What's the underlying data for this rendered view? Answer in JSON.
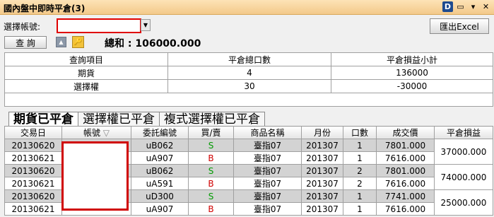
{
  "window": {
    "title": "國內盤中即時平倉(3)"
  },
  "toolbar_icons": [
    "d-app-icon",
    "page-icon",
    "pin-icon",
    "close-icon"
  ],
  "account": {
    "label": "選擇帳號:",
    "value": ""
  },
  "export_label": "匯出Excel",
  "query_label": "查 詢",
  "total": "總和 : 106000.000",
  "summary": {
    "headers": [
      "查詢項目",
      "平倉總口數",
      "平倉損益小計"
    ],
    "rows": [
      [
        "期貨",
        "4",
        "136000"
      ],
      [
        "選擇權",
        "30",
        "-30000"
      ]
    ]
  },
  "tabs": [
    "期貨已平倉",
    "選擇權已平倉",
    "複式選擇權已平倉"
  ],
  "detail": {
    "headers": [
      "交易日",
      "帳號",
      "委託編號",
      "買/賣",
      "商品名稱",
      "月份",
      "口數",
      "成交價",
      "平倉損益"
    ],
    "sort_icon": "▽",
    "rows": [
      {
        "date": "20130620",
        "order": "uB062",
        "side": "S",
        "product": "臺指07",
        "month": "201307",
        "qty": "1",
        "price": "7801.000"
      },
      {
        "date": "20130621",
        "order": "uA907",
        "side": "B",
        "product": "臺指07",
        "month": "201307",
        "qty": "1",
        "price": "7616.000"
      },
      {
        "date": "20130620",
        "order": "uB062",
        "side": "S",
        "product": "臺指07",
        "month": "201307",
        "qty": "2",
        "price": "7801.000"
      },
      {
        "date": "20130621",
        "order": "uA591",
        "side": "B",
        "product": "臺指07",
        "month": "201307",
        "qty": "2",
        "price": "7616.000"
      },
      {
        "date": "20130620",
        "order": "uD300",
        "side": "S",
        "product": "臺指07",
        "month": "201307",
        "qty": "1",
        "price": "7741.000"
      },
      {
        "date": "20130621",
        "order": "uA907",
        "side": "B",
        "product": "臺指07",
        "month": "201307",
        "qty": "1",
        "price": "7616.000"
      }
    ],
    "pnl": [
      "37000.000",
      "74000.000",
      "25000.000"
    ]
  }
}
